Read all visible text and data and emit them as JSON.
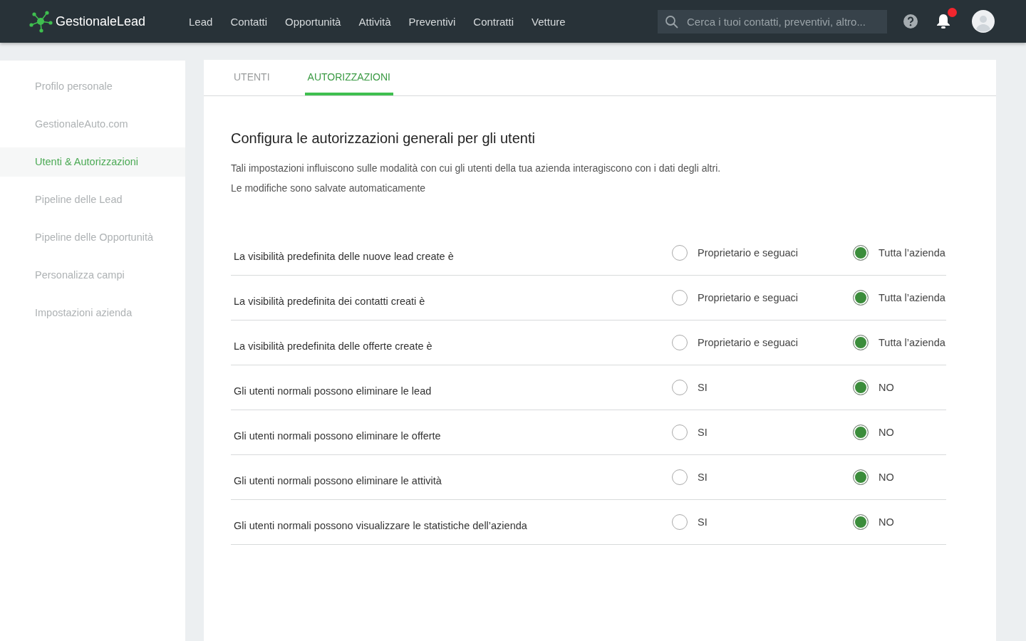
{
  "app": {
    "logo_text": "GestionaleLead"
  },
  "nav": [
    {
      "label": "Lead"
    },
    {
      "label": "Contatti"
    },
    {
      "label": "Opportunità"
    },
    {
      "label": "Attività"
    },
    {
      "label": "Preventivi"
    },
    {
      "label": "Contratti"
    },
    {
      "label": "Vetture"
    }
  ],
  "search": {
    "placeholder": "Cerca i tuoi contatti, preventivi, altro..."
  },
  "notifications": {
    "unread": true
  },
  "sidebar": {
    "items": [
      {
        "label": "Profilo personale",
        "selected": false
      },
      {
        "label": "GestionaleAuto.com",
        "selected": false
      },
      {
        "label": "Utenti & Autorizzazioni",
        "selected": true
      },
      {
        "label": "Pipeline delle Lead",
        "selected": false
      },
      {
        "label": "Pipeline delle Opportunità",
        "selected": false
      },
      {
        "label": "Personalizza campi",
        "selected": false
      },
      {
        "label": "Impostazioni azienda",
        "selected": false
      }
    ]
  },
  "tabs": [
    {
      "label": "UTENTI",
      "selected": false
    },
    {
      "label": "AUTORIZZAZIONI",
      "selected": true
    }
  ],
  "heading": "Configura le autorizzazioni generali per gli utenti",
  "description": [
    "Tali impostazioni influiscono sulle modalità con cui gli utenti della tua azienda interagiscono con i dati degli altri.",
    "Le modifiche sono salvate automaticamente"
  ],
  "settings": [
    {
      "label": "La visibilità predefinita delle nuove lead create è",
      "options": [
        {
          "label": "Proprietario e seguaci",
          "selected": false
        },
        {
          "label": "Tutta l’azienda",
          "selected": true
        }
      ]
    },
    {
      "label": "La visibilità predefinita dei contatti creati è",
      "options": [
        {
          "label": "Proprietario e seguaci",
          "selected": false
        },
        {
          "label": "Tutta l’azienda",
          "selected": true
        }
      ]
    },
    {
      "label": "La visibilità predefinita delle offerte create è",
      "options": [
        {
          "label": "Proprietario e seguaci",
          "selected": false
        },
        {
          "label": "Tutta l’azienda",
          "selected": true
        }
      ]
    },
    {
      "label": "Gli utenti normali possono eliminare le lead",
      "options": [
        {
          "label": "SI",
          "selected": false
        },
        {
          "label": "NO",
          "selected": true
        }
      ]
    },
    {
      "label": "Gli utenti normali possono eliminare le offerte",
      "options": [
        {
          "label": "SI",
          "selected": false
        },
        {
          "label": "NO",
          "selected": true
        }
      ]
    },
    {
      "label": "Gli utenti normali possono eliminare le attività",
      "options": [
        {
          "label": "SI",
          "selected": false
        },
        {
          "label": "NO",
          "selected": true
        }
      ]
    },
    {
      "label": "Gli utenti normali possono visualizzare le statistiche dell’azienda",
      "options": [
        {
          "label": "SI",
          "selected": false
        },
        {
          "label": "NO",
          "selected": true
        }
      ]
    }
  ]
}
